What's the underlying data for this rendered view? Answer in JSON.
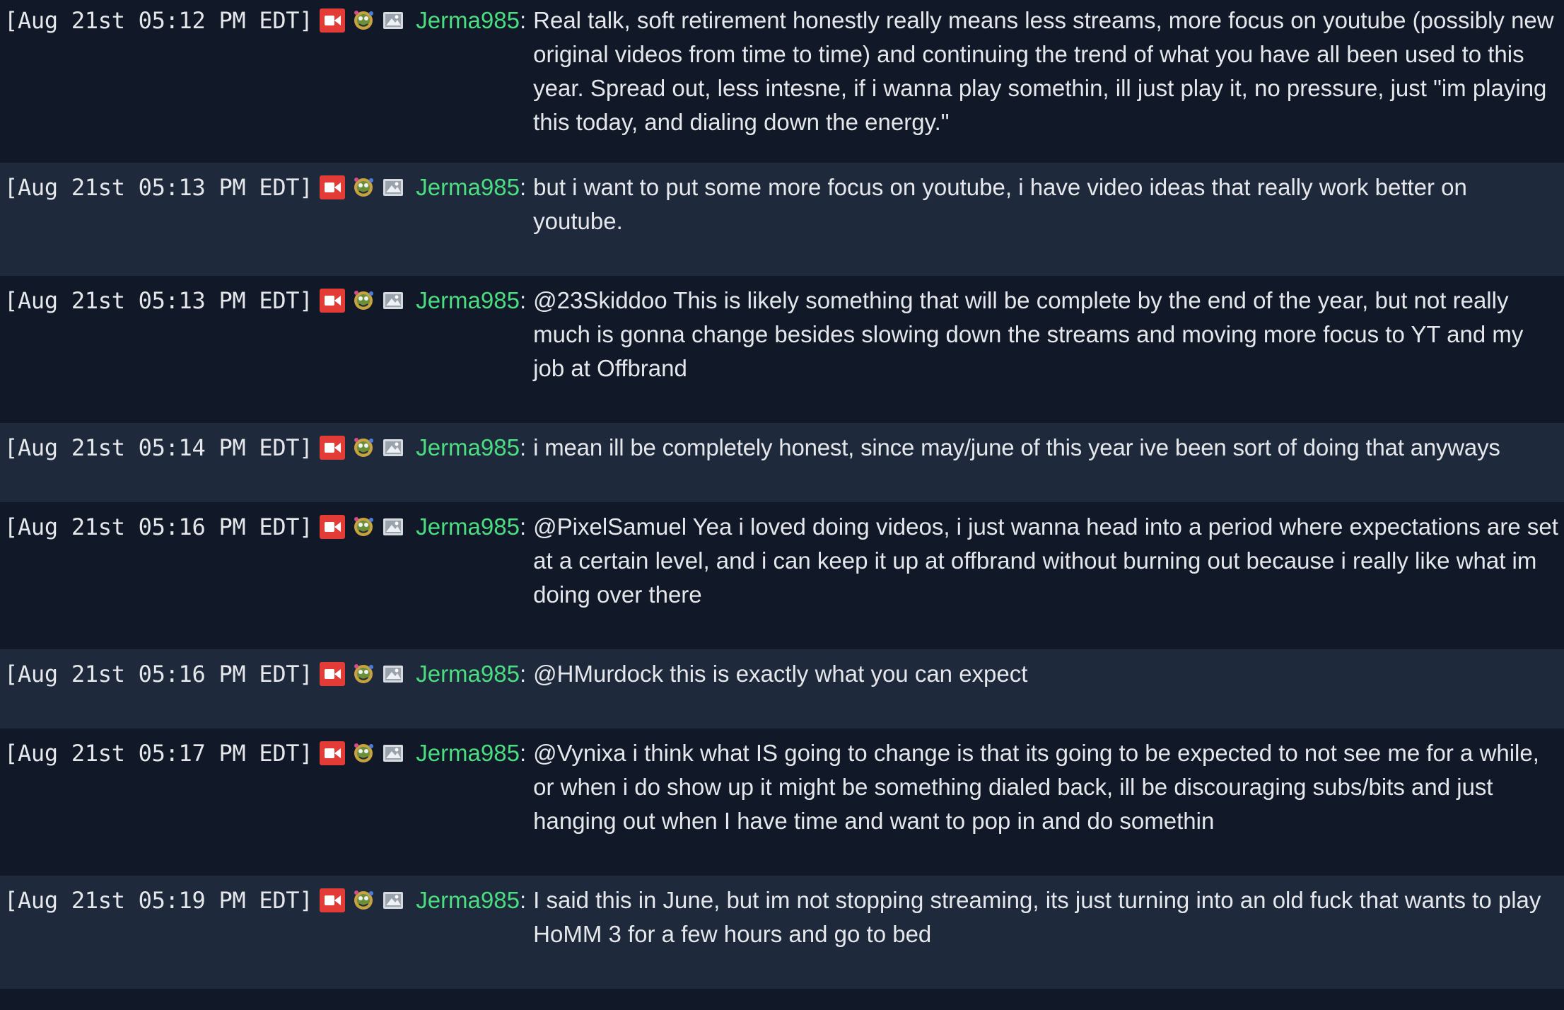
{
  "messages": [
    {
      "timestamp": "[Aug 21st 05:12 PM EDT]",
      "username": "Jerma985",
      "text": "Real talk, soft retirement honestly really means less streams, more focus on youtube (possibly new original videos from time to time) and continuing the trend of what you have all been used to this year. Spread out, less intesne, if i wanna play somethin, ill just play it, no pressure, just \"im playing this today, and dialing down the energy.\""
    },
    {
      "timestamp": "[Aug 21st 05:13 PM EDT]",
      "username": "Jerma985",
      "text": "but i want to put some more focus on youtube, i have video ideas that really work better on youtube."
    },
    {
      "timestamp": "[Aug 21st 05:13 PM EDT]",
      "username": "Jerma985",
      "text": "@23Skiddoo This is likely something that will be complete by the end of the year, but not really much is gonna change besides slowing down the streams and moving more focus to YT and my job at Offbrand"
    },
    {
      "timestamp": "[Aug 21st 05:14 PM EDT]",
      "username": "Jerma985",
      "text": "i mean ill be completely honest, since may/june of this year ive been sort of doing that anyways"
    },
    {
      "timestamp": "[Aug 21st 05:16 PM EDT]",
      "username": "Jerma985",
      "text": "@PixelSamuel Yea i loved doing videos, i just wanna head into a period where expectations are set at a certain level, and i can keep it up at offbrand without burning out because i really like what im doing over there"
    },
    {
      "timestamp": "[Aug 21st 05:16 PM EDT]",
      "username": "Jerma985",
      "text": "@HMurdock this is exactly what you can expect"
    },
    {
      "timestamp": "[Aug 21st 05:17 PM EDT]",
      "username": "Jerma985",
      "text": "@Vynixa i think what IS going to change is that its going to be expected to not see me for a while, or when i do show up it might be something dialed back, ill be discouraging subs/bits and just hanging out when I have time and want to pop in and do somethin"
    },
    {
      "timestamp": "[Aug 21st 05:19 PM EDT]",
      "username": "Jerma985",
      "text": "I said this in June, but im not stopping streaming, its just turning into an old fuck that wants to play HoMM 3 for a few hours and go to bed"
    }
  ],
  "badges": [
    "broadcaster-icon",
    "subscriber-icon",
    "sub-gifter-icon"
  ],
  "colors": {
    "background_odd": "#111827",
    "background_even": "#1e293b",
    "username": "#4ade80",
    "text": "#e5e7eb",
    "broadcaster_badge": "#e33b35"
  }
}
